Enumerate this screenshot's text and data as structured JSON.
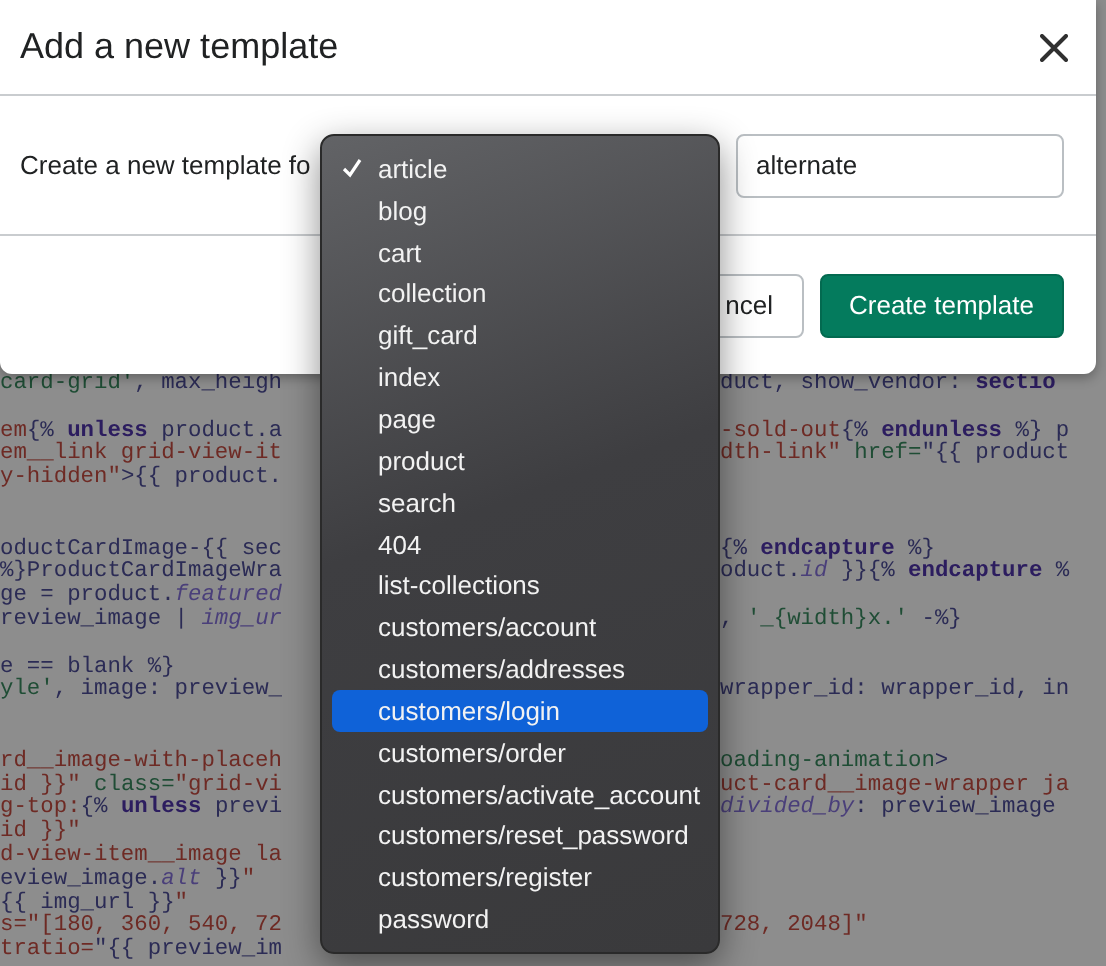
{
  "dialog": {
    "title": "Add a new template",
    "label": "Create a new template fo",
    "name_input": {
      "value": "alternate"
    },
    "buttons": [
      {
        "label": "ncel",
        "kind": "secondary"
      },
      {
        "label": "Create template",
        "kind": "primary"
      }
    ]
  },
  "editor": {
    "lines": [
      {
        "kind": "code",
        "left": [
          {
            "text": "card-grid'",
            "kind": "string"
          },
          {
            "text": ", max_heigh",
            "kind": "plain"
          }
        ],
        "right": [
          {
            "text": "duct, show_vendor: ",
            "kind": "plain"
          },
          {
            "text": "sectio",
            "kind": "keyword"
          }
        ]
      },
      {
        "kind": "blank"
      },
      {
        "kind": "code",
        "left": [
          {
            "text": "em",
            "kind": "tag"
          },
          {
            "text": "{% ",
            "kind": "plain"
          },
          {
            "text": "unless",
            "kind": "keyword"
          },
          {
            "text": " product.a",
            "kind": "plain"
          }
        ],
        "right": [
          {
            "text": "-sold-out",
            "kind": "tag"
          },
          {
            "text": "{% ",
            "kind": "plain"
          },
          {
            "text": "endunless",
            "kind": "keyword"
          },
          {
            "text": " %} p",
            "kind": "plain"
          }
        ]
      },
      {
        "kind": "code",
        "left": [
          {
            "text": "em__link grid-view-it",
            "kind": "tag"
          }
        ],
        "right": [
          {
            "text": "dth-link\"",
            "kind": "tag"
          },
          {
            "text": " href=",
            "kind": "string"
          },
          {
            "text": "\"{{ product",
            "kind": "plain"
          }
        ]
      },
      {
        "kind": "code",
        "left": [
          {
            "text": "y-hidden\"",
            "kind": "tag"
          },
          {
            "text": ">{{ product.",
            "kind": "plain"
          }
        ]
      },
      {
        "kind": "blank"
      },
      {
        "kind": "blank"
      },
      {
        "kind": "code",
        "left": [
          {
            "text": "oductCardImage-{{ sec",
            "kind": "plain"
          }
        ],
        "right": [
          {
            "text": "{% ",
            "kind": "plain"
          },
          {
            "text": "endcapture",
            "kind": "keyword"
          },
          {
            "text": " %}",
            "kind": "plain"
          }
        ]
      },
      {
        "kind": "code",
        "left": [
          {
            "text": "%}ProductCardImageWra",
            "kind": "plain"
          }
        ],
        "right": [
          {
            "text": "oduct.",
            "kind": "plain"
          },
          {
            "text": "id",
            "kind": "filter"
          },
          {
            "text": " }}{% ",
            "kind": "plain"
          },
          {
            "text": "endcapture",
            "kind": "keyword"
          },
          {
            "text": " %",
            "kind": "plain"
          }
        ]
      },
      {
        "kind": "code",
        "left": [
          {
            "text": "ge = product.",
            "kind": "plain"
          },
          {
            "text": "featured",
            "kind": "filter"
          }
        ]
      },
      {
        "kind": "code",
        "left": [
          {
            "text": "review_image | ",
            "kind": "plain"
          },
          {
            "text": "img_ur",
            "kind": "filter"
          }
        ],
        "right": [
          {
            "text": ", ",
            "kind": "plain"
          },
          {
            "text": "'_{width}x.'",
            "kind": "string"
          },
          {
            "text": " -%}",
            "kind": "plain"
          }
        ]
      },
      {
        "kind": "blank"
      },
      {
        "kind": "code",
        "left": [
          {
            "text": "e == blank %}",
            "kind": "plain"
          }
        ]
      },
      {
        "kind": "code",
        "left": [
          {
            "text": "yle'",
            "kind": "string"
          },
          {
            "text": ", image: preview_",
            "kind": "plain"
          }
        ],
        "right": [
          {
            "text": "wrapper_id: wrapper_id, in",
            "kind": "plain"
          }
        ]
      },
      {
        "kind": "blank"
      },
      {
        "kind": "blank"
      },
      {
        "kind": "code",
        "left": [
          {
            "text": "rd__image-with-placeh",
            "kind": "tag"
          }
        ],
        "right": [
          {
            "text": "oading-animation",
            "kind": "string"
          },
          {
            "text": ">",
            "kind": "plain"
          }
        ]
      },
      {
        "kind": "code",
        "left": [
          {
            "text": "id }}\"",
            "kind": "tag"
          },
          {
            "text": " class=",
            "kind": "string"
          },
          {
            "text": "\"grid-vi",
            "kind": "tag"
          }
        ],
        "right": [
          {
            "text": "uct-card__image-wrapper ja",
            "kind": "tag"
          }
        ]
      },
      {
        "kind": "code",
        "left": [
          {
            "text": "g-top:",
            "kind": "tag"
          },
          {
            "text": "{% ",
            "kind": "plain"
          },
          {
            "text": "unless",
            "kind": "keyword"
          },
          {
            "text": " previ",
            "kind": "plain"
          }
        ],
        "right": [
          {
            "text": "divided_by",
            "kind": "filter"
          },
          {
            "text": ": preview_image",
            "kind": "plain"
          }
        ]
      },
      {
        "kind": "code",
        "left": [
          {
            "text": "id }}\"",
            "kind": "tag"
          }
        ]
      },
      {
        "kind": "code",
        "left": [
          {
            "text": "d-view-item__image la",
            "kind": "tag"
          }
        ]
      },
      {
        "kind": "code",
        "left": [
          {
            "text": "eview_image.",
            "kind": "plain"
          },
          {
            "text": "alt",
            "kind": "filter"
          },
          {
            "text": " }}",
            "kind": "plain"
          },
          {
            "text": "\"",
            "kind": "tag"
          }
        ]
      },
      {
        "kind": "code",
        "left": [
          {
            "text": "{{ img_url }}",
            "kind": "plain"
          },
          {
            "text": "\"",
            "kind": "tag"
          }
        ]
      },
      {
        "kind": "code",
        "left": [
          {
            "text": "s=\"[180, 360, 540, 72",
            "kind": "tag"
          }
        ],
        "right": [
          {
            "text": "728, 2048]\"",
            "kind": "tag"
          }
        ]
      },
      {
        "kind": "code",
        "left": [
          {
            "text": "tratio=",
            "kind": "tag"
          },
          {
            "text": "\"{{ preview_im",
            "kind": "plain"
          }
        ]
      }
    ]
  },
  "template_menu": {
    "items": [
      {
        "label": "article",
        "checked": true,
        "selected": false
      },
      {
        "label": "blog",
        "checked": false,
        "selected": false
      },
      {
        "label": "cart",
        "checked": false,
        "selected": false
      },
      {
        "label": "collection",
        "checked": false,
        "selected": false
      },
      {
        "label": "gift_card",
        "checked": false,
        "selected": false
      },
      {
        "label": "index",
        "checked": false,
        "selected": false
      },
      {
        "label": "page",
        "checked": false,
        "selected": false
      },
      {
        "label": "product",
        "checked": false,
        "selected": false
      },
      {
        "label": "search",
        "checked": false,
        "selected": false
      },
      {
        "label": "404",
        "checked": false,
        "selected": false
      },
      {
        "label": "list-collections",
        "checked": false,
        "selected": false
      },
      {
        "label": "customers/account",
        "checked": false,
        "selected": false
      },
      {
        "label": "customers/addresses",
        "checked": false,
        "selected": false
      },
      {
        "label": "customers/login",
        "checked": false,
        "selected": true
      },
      {
        "label": "customers/order",
        "checked": false,
        "selected": false
      },
      {
        "label": "customers/activate_account",
        "checked": false,
        "selected": false
      },
      {
        "label": "customers/reset_password",
        "checked": false,
        "selected": false
      },
      {
        "label": "customers/register",
        "checked": false,
        "selected": false
      },
      {
        "label": "password",
        "checked": false,
        "selected": false
      }
    ]
  }
}
